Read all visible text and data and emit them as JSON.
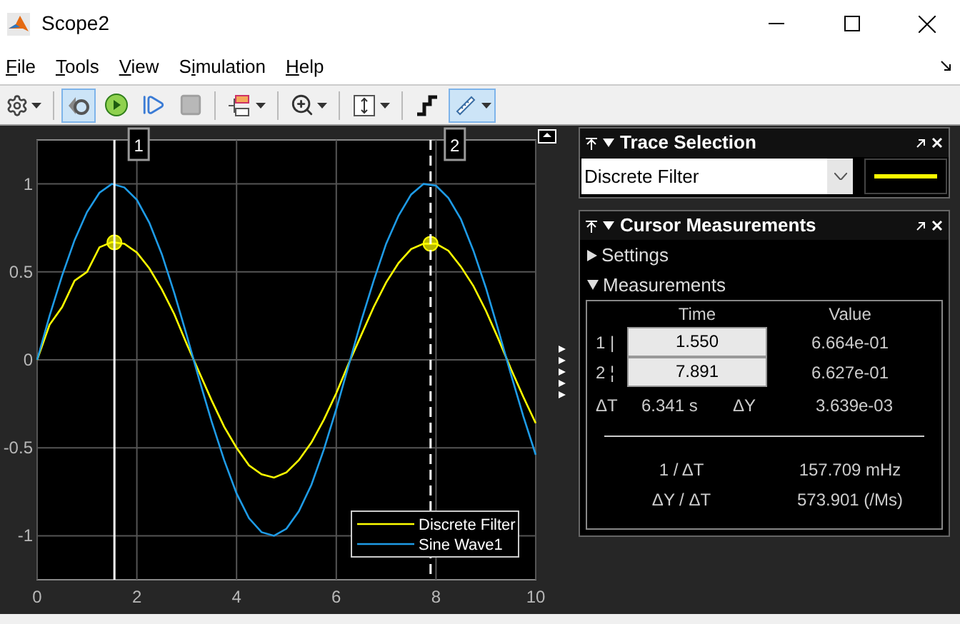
{
  "window": {
    "title": "Scope2"
  },
  "menu": [
    {
      "key": "F",
      "after": "ile"
    },
    {
      "key": "T",
      "after": "ools"
    },
    {
      "key": "V",
      "after": "iew"
    },
    {
      "before": "S",
      "key": "i",
      "after": "mulation"
    },
    {
      "key": "H",
      "after": "elp"
    }
  ],
  "toolbar": [
    {
      "kind": "settings",
      "has_menu": true,
      "selected": false,
      "disabled": false
    },
    {
      "kind": "separator"
    },
    {
      "kind": "highlight",
      "has_menu": false,
      "selected": true,
      "disabled": false
    },
    {
      "kind": "run",
      "has_menu": false,
      "selected": false,
      "disabled": false
    },
    {
      "kind": "step",
      "has_menu": false,
      "selected": false,
      "disabled": false
    },
    {
      "kind": "stop",
      "has_menu": false,
      "selected": false,
      "disabled": true
    },
    {
      "kind": "separator"
    },
    {
      "kind": "signals",
      "has_menu": true,
      "selected": false,
      "disabled": false
    },
    {
      "kind": "separator"
    },
    {
      "kind": "zoom",
      "has_menu": true,
      "selected": false,
      "disabled": false
    },
    {
      "kind": "separator"
    },
    {
      "kind": "scale",
      "has_menu": true,
      "selected": false,
      "disabled": false
    },
    {
      "kind": "separator"
    },
    {
      "kind": "triggers",
      "has_menu": false,
      "selected": false,
      "disabled": false
    },
    {
      "kind": "cursors",
      "has_menu": true,
      "selected": true,
      "disabled": false
    }
  ],
  "plot": {
    "chart_data": {
      "type": "line",
      "x": [
        0,
        0.25,
        0.5,
        0.75,
        1,
        1.25,
        1.5,
        1.75,
        2,
        2.25,
        2.5,
        2.75,
        3,
        3.25,
        3.5,
        3.75,
        4,
        4.25,
        4.5,
        4.75,
        5,
        5.25,
        5.5,
        5.75,
        6,
        6.25,
        6.5,
        6.75,
        7,
        7.25,
        7.5,
        7.75,
        8,
        8.25,
        8.5,
        8.75,
        9,
        9.25,
        9.5,
        9.75,
        10
      ],
      "series": [
        {
          "name": "Discrete Filter",
          "color": "#ffff00",
          "values": [
            0,
            0.2,
            0.3,
            0.45,
            0.5,
            0.64,
            0.67,
            0.66,
            0.61,
            0.52,
            0.4,
            0.26,
            0.09,
            -0.07,
            -0.23,
            -0.38,
            -0.5,
            -0.6,
            -0.65,
            -0.67,
            -0.64,
            -0.57,
            -0.47,
            -0.34,
            -0.19,
            -0.02,
            0.14,
            0.3,
            0.44,
            0.55,
            0.63,
            0.66,
            0.66,
            0.62,
            0.53,
            0.42,
            0.28,
            0.12,
            -0.05,
            -0.21,
            -0.36
          ]
        },
        {
          "name": "Sine Wave1",
          "color": "#1e9be6",
          "values": [
            0,
            0.25,
            0.48,
            0.68,
            0.84,
            0.95,
            1,
            0.98,
            0.91,
            0.78,
            0.6,
            0.38,
            0.14,
            -0.11,
            -0.35,
            -0.57,
            -0.76,
            -0.9,
            -0.98,
            -1,
            -0.96,
            -0.86,
            -0.71,
            -0.51,
            -0.28,
            -0.03,
            0.22,
            0.45,
            0.66,
            0.82,
            0.94,
            1,
            0.99,
            0.92,
            0.8,
            0.62,
            0.41,
            0.17,
            -0.08,
            -0.32,
            -0.54
          ]
        }
      ],
      "xlim": [
        0,
        10
      ],
      "ylim": [
        -1.25,
        1.25
      ],
      "xticks": [
        0,
        2,
        4,
        6,
        8,
        10
      ],
      "yticks": [
        -1,
        -0.5,
        0,
        0.5,
        1
      ],
      "grid": true,
      "legend": "lower right",
      "ref_lines": [
        {
          "axis": "x",
          "value": 1.55
        },
        {
          "axis": "x",
          "value": 7.891
        }
      ]
    },
    "cursor_tags": [
      "1",
      "2"
    ]
  },
  "trace_selection": {
    "title": "Trace Selection",
    "selected_trace": "Discrete Filter"
  },
  "cursor_measurements": {
    "title": "Cursor Measurements",
    "sections": [
      {
        "label": "Settings",
        "expanded": false
      },
      {
        "label": "Measurements",
        "expanded": true
      }
    ],
    "columns": [
      "Time",
      "Value"
    ],
    "rows": [
      {
        "cursor": "1 |",
        "time": "1.550",
        "value": "6.664e-01"
      },
      {
        "cursor": "2 ¦",
        "time": "7.891",
        "value": "6.627e-01"
      }
    ],
    "delta": {
      "dt_label": "ΔT",
      "dt": "6.341 s",
      "dy_label": "ΔY",
      "dy": "3.639e-03"
    },
    "derived": [
      {
        "label": "1 / ΔT",
        "value": "157.709 mHz"
      },
      {
        "label": "ΔY / ΔT",
        "value": "573.901 (/Ms)"
      }
    ]
  }
}
